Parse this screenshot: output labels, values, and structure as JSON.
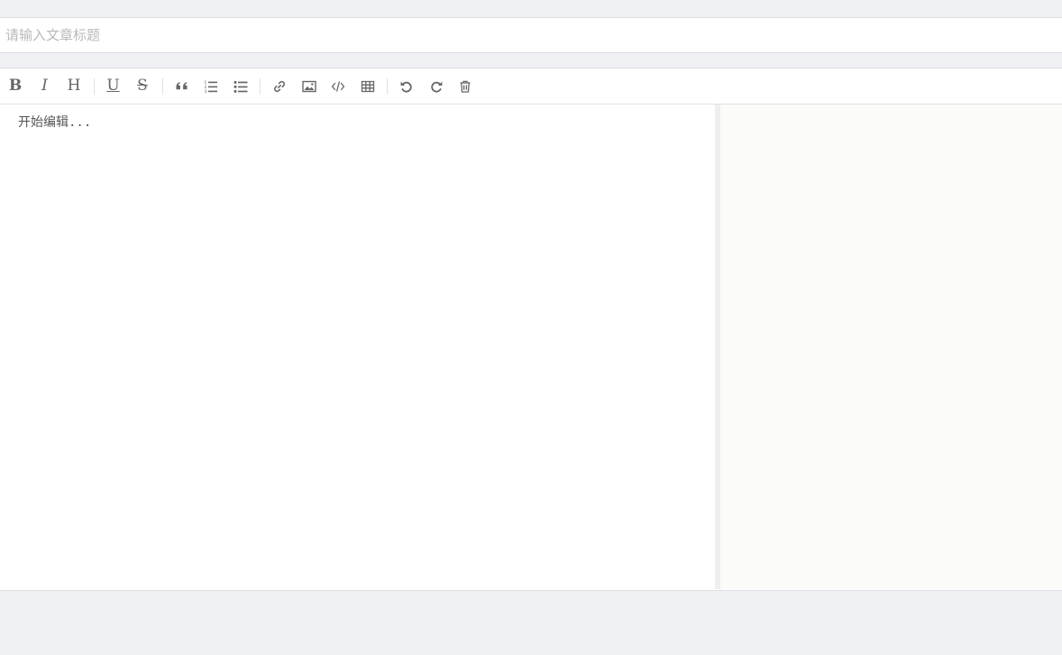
{
  "title_input": {
    "placeholder": "请输入文章标题",
    "value": ""
  },
  "editor": {
    "placeholder": "开始编辑...",
    "value": ""
  },
  "toolbar": {
    "bold_label": "B",
    "italic_label": "I",
    "heading_label": "H",
    "underline_label": "U",
    "strikethrough_label": "S",
    "icons": [
      "bold",
      "italic",
      "heading",
      "underline",
      "strikethrough",
      "quote",
      "ordered-list",
      "unordered-list",
      "link",
      "image",
      "code",
      "table",
      "undo",
      "redo",
      "trash"
    ]
  },
  "colors": {
    "page_background": "#f0f1f5",
    "panel_background": "#ffffff",
    "preview_background": "#fbfbfa",
    "icon_color": "#6a6a6a",
    "placeholder_color": "#b9b9b9"
  }
}
